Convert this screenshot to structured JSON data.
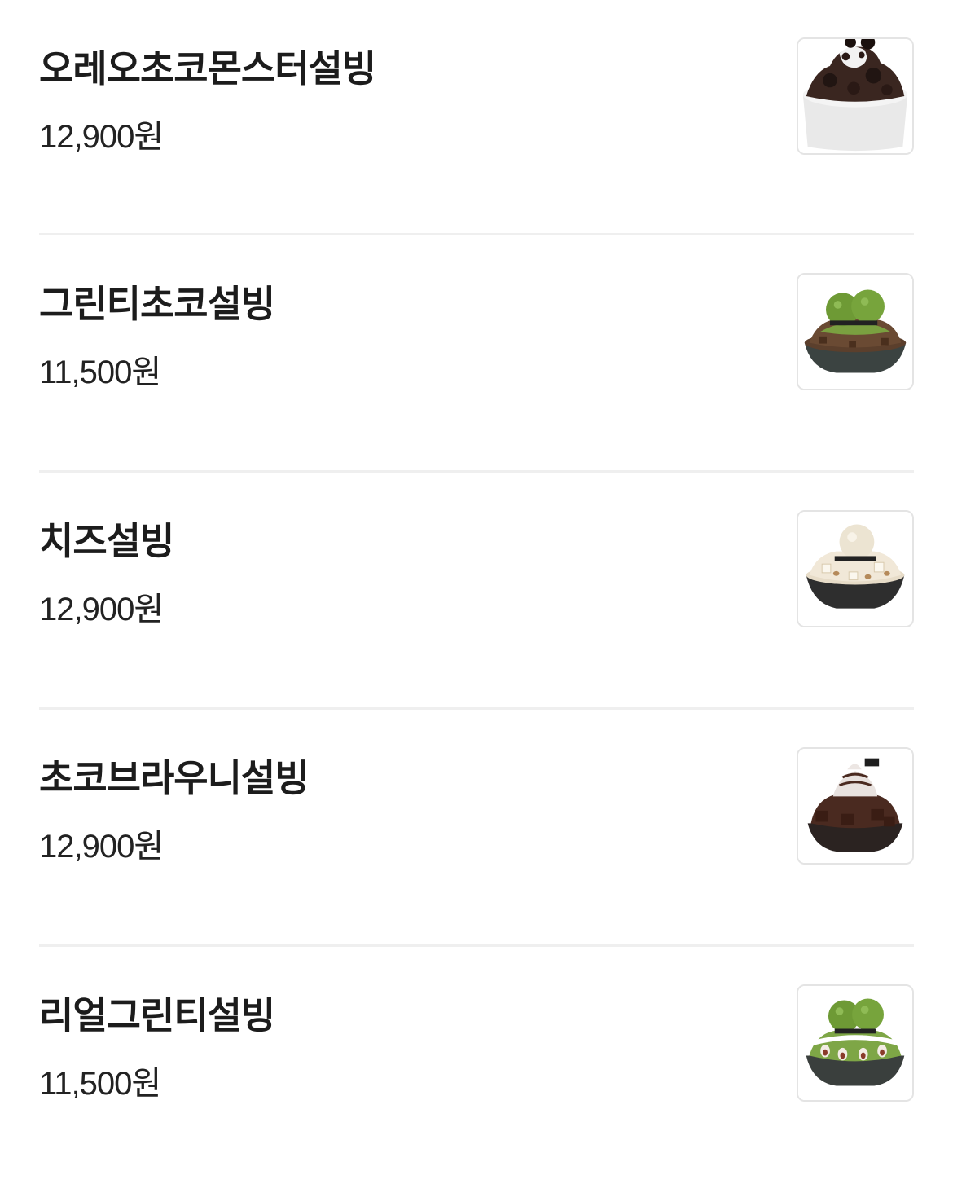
{
  "menu": {
    "items": [
      {
        "name": "오레오초코몬스터설빙",
        "price": "12,900원",
        "image_icon": "oreo-choco-bingsu-photo"
      },
      {
        "name": "그린티초코설빙",
        "price": "11,500원",
        "image_icon": "greentea-choco-bingsu-photo"
      },
      {
        "name": "치즈설빙",
        "price": "12,900원",
        "image_icon": "cheese-bingsu-photo"
      },
      {
        "name": "초코브라우니설빙",
        "price": "12,900원",
        "image_icon": "choco-brownie-bingsu-photo"
      },
      {
        "name": "리얼그린티설빙",
        "price": "11,500원",
        "image_icon": "real-greentea-bingsu-photo"
      }
    ]
  },
  "colors": {
    "divider": "#efefef",
    "thumb_border": "#e4e4e4",
    "text": "#1c1c1c"
  }
}
